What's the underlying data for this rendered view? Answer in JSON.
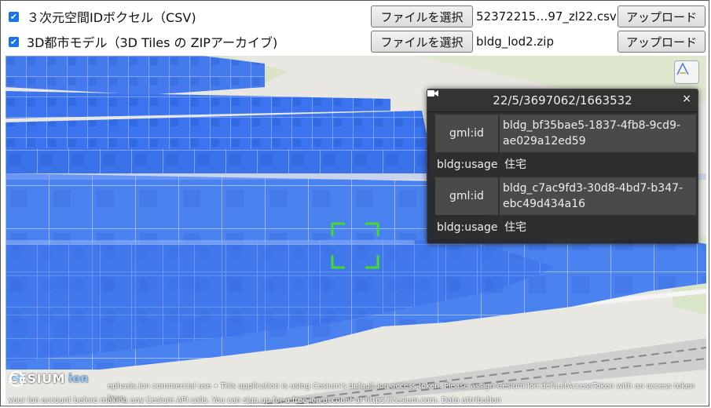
{
  "controls": [
    {
      "label": "３次元空間IDボクセル（CSV)",
      "file_button": "ファイルを選択",
      "file_name": "52372215…97_zl22.csv",
      "upload_button": "アップロード",
      "checked": true
    },
    {
      "label": "3D都市モデル（3D Tiles の ZIPアーカイブ)",
      "file_button": "ファイルを選択",
      "file_name": "bldg_lod2.zip",
      "upload_button": "アップロード",
      "checked": true
    }
  ],
  "viewer": {
    "voxel_color": "#2f6bea",
    "home_icon": "home-icon",
    "infobox": {
      "title": "22/5/3697062/1663532",
      "close_label": "×",
      "rows": [
        {
          "key": "gml:id",
          "value": "bldg_bf35bae5-1837-4fb8-9cd9-ae029a12ed59"
        },
        {
          "key": "bldg:usage",
          "value": "住宅"
        },
        {
          "key": "gml:id",
          "value": "bldg_c7ac9fd3-30d8-4bd7-b347-ebc49d434a16"
        },
        {
          "key": "bldg:usage",
          "value": "住宅"
        }
      ]
    },
    "credits": {
      "logo": "CESIUM",
      "logo_suffix": "ion",
      "line1": "ephasis.ion commercial use • This application is using Cesium's default ion access token. Please assign Cesium.Ion.defaultAccessToken with an access token from",
      "line2": "your ion account before making any Cesium API calls. You can sign up for a free ion account at https://cesium.com.   Data attribution"
    }
  }
}
